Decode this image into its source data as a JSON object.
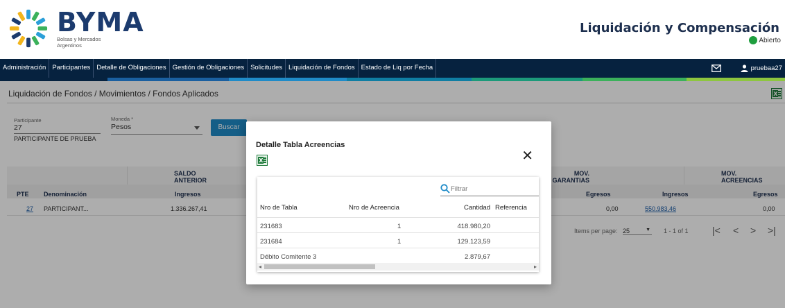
{
  "header": {
    "brand": "BYMA",
    "brand_sub": "Bolsas y Mercados Argentinos",
    "app_title": "Liquidación y Compensación",
    "status": "Abierto",
    "status_color": "#1e9e3e"
  },
  "nav": {
    "items": [
      "Administración",
      "Participantes",
      "Detalle de Obligaciones",
      "Gestión de Obligaciones",
      "Solicitudes",
      "Liquidación de Fondos",
      "Estado de Liq por Fecha"
    ],
    "user": "pruebaa27",
    "mail_icon": "mail-icon",
    "user_icon": "user-icon"
  },
  "colors": {
    "nav_bg": "#06223f",
    "accent_blue": "#1f8bc8",
    "accent_green": "#3bb15b"
  },
  "breadcrumb": "Liquidación de Fondos / Movimientos / Fondos Aplicados",
  "filters": {
    "participante_label": "Participante",
    "participante_value": "27",
    "participante_name": "PARTICIPANTE DE PRUEBA",
    "moneda_label": "Moneda *",
    "moneda_value": "Pesos",
    "buscar_label": "Buscar"
  },
  "table": {
    "group_headers": [
      "SALDO ANTERIOR",
      "MOV. GARANTIAS",
      "MOV. ACREENCIAS"
    ],
    "col_pte": "PTE",
    "col_denominacion": "Denominación",
    "col_ingresos": "Ingresos",
    "col_egresos": "Egresos",
    "row": {
      "pte": "27",
      "denominacion": "PARTICIPANT...",
      "saldo": "1.336.267,41",
      "gar_egresos": "0,00",
      "acr_ingresos": "550.983,46",
      "acr_egresos": "0,00"
    },
    "paginator": {
      "items_label": "Items per page:",
      "page_size": "25",
      "range": "1 - 1 of 1"
    }
  },
  "modal": {
    "title": "Detalle Tabla Acreencias",
    "filter_placeholder": "Filtrar",
    "columns": [
      "Nro de Tabla",
      "Nro de Acreencia",
      "Cantidad",
      "Referencia"
    ],
    "rows": [
      {
        "tabla": "231683",
        "acreencia": "1",
        "cantidad": "418.980,20",
        "referencia": ""
      },
      {
        "tabla": "231684",
        "acreencia": "1",
        "cantidad": "129.123,59",
        "referencia": ""
      },
      {
        "tabla": "Débito Comitente 3",
        "acreencia": "",
        "cantidad": "2.879,67",
        "referencia": ""
      }
    ]
  }
}
